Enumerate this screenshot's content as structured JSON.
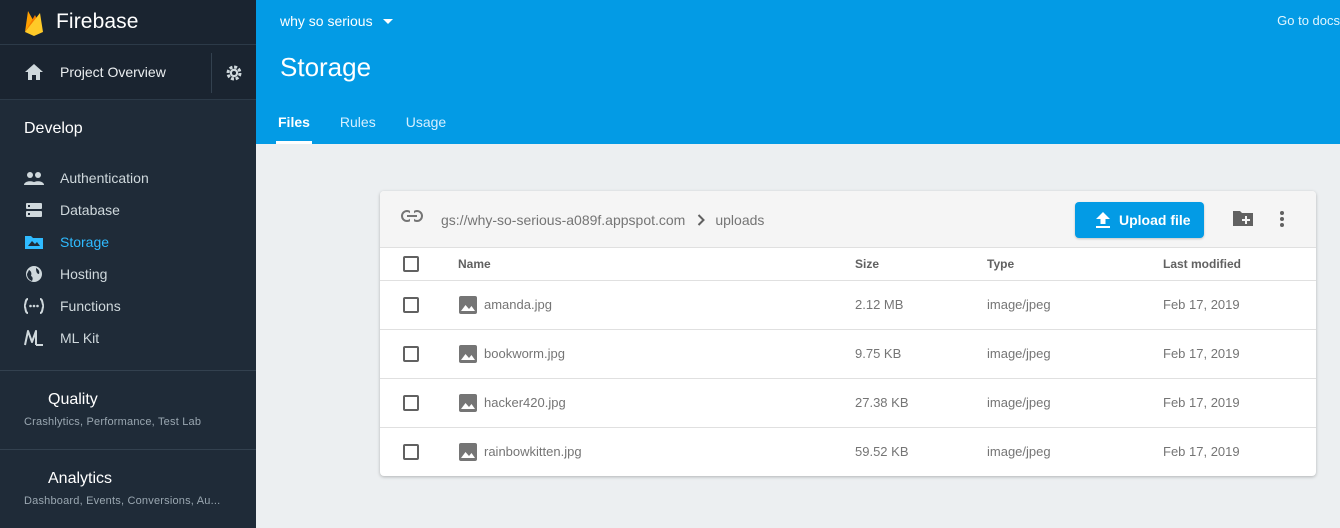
{
  "brand": {
    "name": "Firebase"
  },
  "sidebar": {
    "overview_label": "Project Overview",
    "develop_title": "Develop",
    "items": [
      {
        "label": "Authentication",
        "icon": "people-icon",
        "active": false
      },
      {
        "label": "Database",
        "icon": "database-icon",
        "active": false
      },
      {
        "label": "Storage",
        "icon": "storage-folder-icon",
        "active": true
      },
      {
        "label": "Hosting",
        "icon": "globe-icon",
        "active": false
      },
      {
        "label": "Functions",
        "icon": "functions-icon",
        "active": false
      },
      {
        "label": "ML Kit",
        "icon": "ml-kit-icon",
        "active": false
      }
    ],
    "quality": {
      "title": "Quality",
      "subtitle": "Crashlytics, Performance, Test Lab"
    },
    "analytics": {
      "title": "Analytics",
      "subtitle": "Dashboard, Events, Conversions, Au..."
    }
  },
  "header": {
    "project_name": "why so serious",
    "docs_link": "Go to docs",
    "title": "Storage",
    "tabs": [
      {
        "label": "Files",
        "active": true
      },
      {
        "label": "Rules",
        "active": false
      },
      {
        "label": "Usage",
        "active": false
      }
    ]
  },
  "browser": {
    "bucket": "gs://why-so-serious-a089f.appspot.com",
    "folder": "uploads",
    "upload_label": "Upload file",
    "columns": {
      "name": "Name",
      "size": "Size",
      "type": "Type",
      "modified": "Last modified"
    },
    "rows": [
      {
        "name": "amanda.jpg",
        "size": "2.12 MB",
        "type": "image/jpeg",
        "modified": "Feb 17, 2019"
      },
      {
        "name": "bookworm.jpg",
        "size": "9.75 KB",
        "type": "image/jpeg",
        "modified": "Feb 17, 2019"
      },
      {
        "name": "hacker420.jpg",
        "size": "27.38 KB",
        "type": "image/jpeg",
        "modified": "Feb 17, 2019"
      },
      {
        "name": "rainbowkitten.jpg",
        "size": "59.52 KB",
        "type": "image/jpeg",
        "modified": "Feb 17, 2019"
      }
    ]
  },
  "colors": {
    "accent": "#039be5",
    "sidebar_bg": "#1f2b38",
    "active_nav": "#2fbbff"
  }
}
